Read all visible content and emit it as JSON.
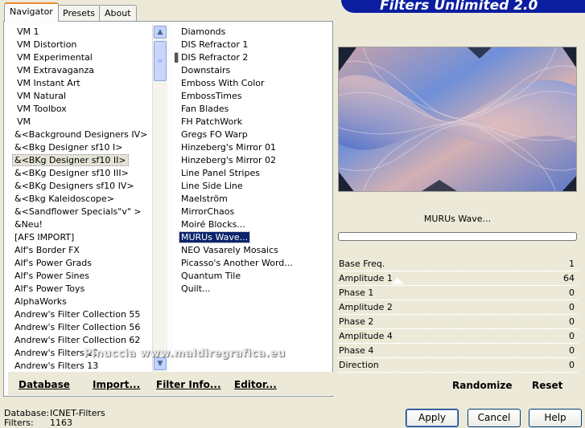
{
  "title": "Filters Unlimited 2.0",
  "tabs": [
    "Navigator",
    "Presets",
    "About"
  ],
  "categories": [
    "VM 1",
    "VM Distortion",
    "VM Experimental",
    "VM Extravaganza",
    "VM Instant Art",
    "VM Natural",
    "VM Toolbox",
    "VM",
    "&<Background Designers IV>",
    "&<Bkg Designer sf10 I>",
    "&<BKg Designer sf10 II>",
    "&<BKg Designer sf10 III>",
    "&<BKg Designers sf10 IV>",
    "&<Bkg Kaleidoscope>",
    "&<Sandflower Specials\"v\" >",
    "&Neu!",
    "[AFS IMPORT]",
    "Alf's Border FX",
    "Alf's Power Grads",
    "Alf's Power Sines",
    "Alf's Power Toys",
    "AlphaWorks",
    "Andrew's Filter Collection 55",
    "Andrew's Filter Collection 56",
    "Andrew's Filter Collection 62",
    "Andrew's Filters 10",
    "Andrew's Filters 13"
  ],
  "highlighted_category": "&<BKg Designer sf10 II>",
  "filters": [
    "Diamonds",
    "DIS Refractor 1",
    "DIS Refractor 2",
    "Downstairs",
    "Emboss With Color",
    "EmbossTimes",
    "Fan Blades",
    "FH PatchWork",
    "Gregs FO Warp",
    "Hinzeberg's Mirror 01",
    "Hinzeberg's Mirror 02",
    "Line Panel Stripes",
    "Line Side Line",
    "Maelström",
    "MirrorChaos",
    "Moiré Blocks...",
    "MURUs Wave...",
    "NEO Vasarely Mosaics",
    "Picasso's Another Word...",
    "Quantum Tile",
    "Quilt..."
  ],
  "selected_filter": "MURUs Wave...",
  "toolbar": {
    "database": "Database",
    "import": "Import...",
    "filter_info": "Filter Info...",
    "editor": "Editor..."
  },
  "preview_caption": "MURUs Wave...",
  "progress": 0,
  "params": [
    {
      "name": "Base Freq.",
      "value": "1"
    },
    {
      "name": "Amplitude 1",
      "value": "64"
    },
    {
      "name": "Phase 1",
      "value": "0"
    },
    {
      "name": "Amplitude 2",
      "value": "0"
    },
    {
      "name": "Phase 2",
      "value": "0"
    },
    {
      "name": "Amplitude 4",
      "value": "0"
    },
    {
      "name": "Phase 4",
      "value": "0"
    },
    {
      "name": "Direction",
      "value": "0"
    }
  ],
  "right_buttons": {
    "randomize": "Randomize",
    "reset": "Reset"
  },
  "status": {
    "database_label": "Database:",
    "database_value": "ICNET-Filters",
    "filters_label": "Filters:",
    "filters_value": "1163"
  },
  "dialog_buttons": {
    "apply": "Apply",
    "cancel": "Cancel",
    "help": "Help"
  },
  "watermark": "Pinuccia www.maldiregrafica.eu",
  "colors": {
    "selection": "#0a246a",
    "banner": "#0b1ea0",
    "dialog_bg": "#ece9d8",
    "param_bg": "#ece9d8"
  }
}
